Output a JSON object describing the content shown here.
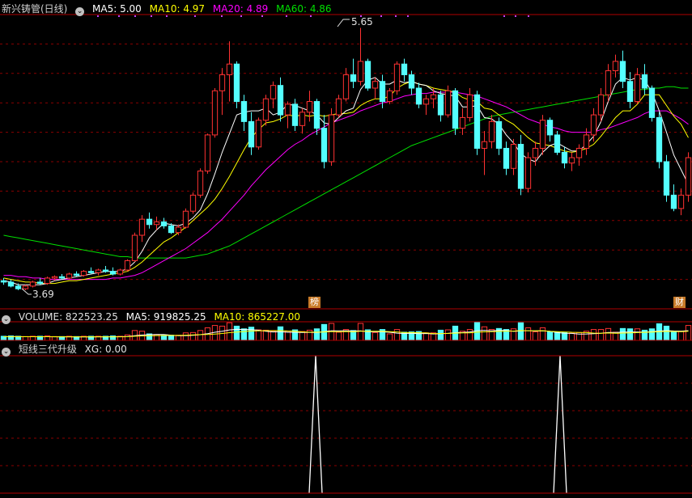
{
  "header": {
    "title": "新兴铸管(日线)",
    "ma5_label": "MA5: 5.00",
    "ma10_label": "MA10: 4.97",
    "ma20_label": "MA20: 4.89",
    "ma60_label": "MA60: 4.86"
  },
  "colors": {
    "up": "#ff3232",
    "down": "#54ffff",
    "ma5": "#ffffff",
    "ma10": "#ffff00",
    "ma20": "#ff00ff",
    "ma60": "#00e000",
    "grid": "#8a0000",
    "border": "#b00000",
    "signal": "#ffffff"
  },
  "price_panel": {
    "high_label": "5.65",
    "low_label": "3.69",
    "event_tags": [
      "榜",
      "财"
    ]
  },
  "volume_panel": {
    "label": "VOLUME: 822523.25",
    "ma5_label": "MA5: 919825.25",
    "ma10_label": "MA10: 865227.00"
  },
  "indicator_panel": {
    "label": "短线三代升级",
    "xg_label": "XG: 0.00"
  },
  "chart_data": {
    "type": "candlestick",
    "y_range": [
      3.55,
      5.75
    ],
    "candles": [
      [
        3.76,
        3.78,
        3.73,
        3.75
      ],
      [
        3.75,
        3.77,
        3.71,
        3.72
      ],
      [
        3.72,
        3.74,
        3.69,
        3.7
      ],
      [
        3.7,
        3.73,
        3.69,
        3.72
      ],
      [
        3.72,
        3.76,
        3.71,
        3.75
      ],
      [
        3.75,
        3.78,
        3.73,
        3.74
      ],
      [
        3.74,
        3.79,
        3.73,
        3.78
      ],
      [
        3.78,
        3.8,
        3.76,
        3.79
      ],
      [
        3.79,
        3.81,
        3.77,
        3.78
      ],
      [
        3.78,
        3.82,
        3.77,
        3.81
      ],
      [
        3.81,
        3.83,
        3.79,
        3.8
      ],
      [
        3.8,
        3.84,
        3.79,
        3.83
      ],
      [
        3.83,
        3.86,
        3.81,
        3.82
      ],
      [
        3.82,
        3.85,
        3.8,
        3.84
      ],
      [
        3.84,
        3.87,
        3.82,
        3.83
      ],
      [
        3.83,
        3.86,
        3.8,
        3.81
      ],
      [
        3.81,
        3.85,
        3.8,
        3.84
      ],
      [
        3.84,
        3.92,
        3.83,
        3.91
      ],
      [
        3.91,
        4.12,
        3.9,
        4.1
      ],
      [
        4.1,
        4.25,
        4.05,
        4.22
      ],
      [
        4.22,
        4.27,
        4.15,
        4.18
      ],
      [
        4.18,
        4.24,
        4.14,
        4.2
      ],
      [
        4.2,
        4.23,
        4.15,
        4.17
      ],
      [
        4.17,
        4.19,
        4.11,
        4.12
      ],
      [
        4.12,
        4.18,
        4.1,
        4.16
      ],
      [
        4.16,
        4.3,
        4.15,
        4.28
      ],
      [
        4.28,
        4.42,
        4.26,
        4.4
      ],
      [
        4.4,
        4.6,
        4.38,
        4.58
      ],
      [
        4.58,
        4.86,
        4.56,
        4.85
      ],
      [
        4.85,
        5.2,
        4.83,
        5.18
      ],
      [
        5.18,
        5.35,
        5.0,
        5.3
      ],
      [
        5.3,
        5.55,
        5.1,
        5.38
      ],
      [
        5.38,
        5.4,
        5.05,
        5.1
      ],
      [
        5.1,
        5.15,
        4.88,
        4.95
      ],
      [
        4.95,
        5.02,
        4.7,
        4.76
      ],
      [
        4.76,
        4.98,
        4.74,
        4.96
      ],
      [
        4.96,
        5.15,
        4.92,
        5.12
      ],
      [
        5.12,
        5.25,
        5.05,
        5.22
      ],
      [
        5.22,
        5.28,
        4.95,
        5.0
      ],
      [
        5.0,
        5.1,
        4.9,
        5.08
      ],
      [
        5.08,
        5.12,
        4.88,
        4.92
      ],
      [
        4.92,
        5.05,
        4.86,
        5.02
      ],
      [
        5.02,
        5.18,
        4.95,
        5.1
      ],
      [
        5.1,
        5.12,
        4.85,
        4.9
      ],
      [
        4.9,
        5.0,
        4.6,
        4.65
      ],
      [
        4.65,
        5.05,
        4.62,
        5.0
      ],
      [
        5.0,
        5.15,
        4.98,
        5.12
      ],
      [
        5.12,
        5.35,
        5.1,
        5.3
      ],
      [
        5.3,
        5.42,
        5.2,
        5.25
      ],
      [
        5.25,
        5.65,
        5.22,
        5.4
      ],
      [
        5.4,
        5.42,
        5.18,
        5.2
      ],
      [
        5.2,
        5.28,
        5.12,
        5.25
      ],
      [
        5.25,
        5.3,
        5.05,
        5.1
      ],
      [
        5.1,
        5.2,
        5.08,
        5.18
      ],
      [
        5.18,
        5.4,
        5.15,
        5.38
      ],
      [
        5.38,
        5.42,
        5.25,
        5.3
      ],
      [
        5.3,
        5.33,
        5.15,
        5.2
      ],
      [
        5.2,
        5.24,
        5.05,
        5.08
      ],
      [
        5.08,
        5.15,
        5.0,
        5.12
      ],
      [
        5.12,
        5.2,
        5.05,
        5.15
      ],
      [
        5.15,
        5.18,
        4.95,
        5.0
      ],
      [
        5.0,
        5.22,
        4.98,
        5.18
      ],
      [
        5.18,
        5.2,
        4.85,
        4.9
      ],
      [
        4.9,
        5.05,
        4.85,
        4.98
      ],
      [
        4.98,
        5.2,
        4.95,
        5.15
      ],
      [
        5.15,
        5.18,
        4.7,
        4.75
      ],
      [
        4.75,
        4.88,
        4.55,
        4.8
      ],
      [
        4.8,
        5.0,
        4.75,
        4.95
      ],
      [
        4.95,
        4.98,
        4.7,
        4.75
      ],
      [
        4.75,
        4.8,
        4.55,
        4.6
      ],
      [
        4.6,
        4.82,
        4.55,
        4.78
      ],
      [
        4.78,
        4.85,
        4.4,
        4.45
      ],
      [
        4.45,
        4.72,
        4.42,
        4.68
      ],
      [
        4.68,
        4.8,
        4.62,
        4.75
      ],
      [
        4.75,
        5.0,
        4.7,
        4.96
      ],
      [
        4.96,
        4.98,
        4.8,
        4.85
      ],
      [
        4.85,
        4.88,
        4.7,
        4.72
      ],
      [
        4.72,
        4.76,
        4.6,
        4.64
      ],
      [
        4.64,
        4.72,
        4.58,
        4.68
      ],
      [
        4.68,
        4.78,
        4.62,
        4.75
      ],
      [
        4.75,
        4.9,
        4.7,
        4.85
      ],
      [
        4.85,
        5.05,
        4.8,
        5.0
      ],
      [
        5.0,
        5.2,
        4.95,
        5.15
      ],
      [
        5.15,
        5.38,
        5.1,
        5.33
      ],
      [
        5.33,
        5.45,
        5.28,
        5.4
      ],
      [
        5.4,
        5.48,
        5.2,
        5.25
      ],
      [
        5.25,
        5.32,
        5.05,
        5.1
      ],
      [
        5.1,
        5.35,
        5.08,
        5.3
      ],
      [
        5.3,
        5.38,
        5.15,
        5.2
      ],
      [
        5.2,
        5.22,
        4.95,
        4.98
      ],
      [
        4.98,
        5.02,
        4.6,
        4.65
      ],
      [
        4.65,
        4.7,
        4.35,
        4.4
      ],
      [
        4.4,
        4.48,
        4.28,
        4.3
      ],
      [
        4.3,
        4.45,
        4.25,
        4.4
      ],
      [
        4.4,
        4.72,
        4.35,
        4.68
      ]
    ],
    "ma5": [
      3.76,
      3.75,
      3.73,
      3.73,
      3.73,
      3.73,
      3.74,
      3.76,
      3.77,
      3.78,
      3.79,
      3.8,
      3.81,
      3.82,
      3.83,
      3.83,
      3.83,
      3.85,
      3.9,
      3.98,
      4.08,
      4.14,
      4.19,
      4.18,
      4.17,
      4.19,
      4.23,
      4.29,
      4.41,
      4.56,
      4.72,
      4.86,
      5.0,
      5.02,
      5.03,
      5.03,
      5.05,
      5.0,
      5.02,
      5.08,
      5.07,
      5.05,
      5.03,
      5.0,
      4.94,
      4.93,
      4.98,
      5.03,
      5.05,
      5.19,
      5.26,
      5.28,
      5.23,
      5.23,
      5.26,
      5.24,
      5.25,
      5.23,
      5.22,
      5.18,
      5.16,
      5.15,
      5.14,
      5.06,
      5.06,
      5.07,
      4.98,
      4.97,
      4.93,
      4.85,
      4.79,
      4.71,
      4.67,
      4.65,
      4.72,
      4.77,
      4.79,
      4.76,
      4.73,
      4.73,
      4.78,
      4.84,
      4.95,
      5.1,
      5.23,
      5.28,
      5.26,
      5.28,
      5.26,
      5.17,
      5.03,
      4.87,
      4.7,
      4.59,
      4.48
    ],
    "ma10": [
      3.78,
      3.77,
      3.76,
      3.75,
      3.75,
      3.74,
      3.74,
      3.74,
      3.75,
      3.76,
      3.76,
      3.77,
      3.78,
      3.79,
      3.8,
      3.81,
      3.82,
      3.83,
      3.86,
      3.9,
      3.95,
      4.0,
      4.05,
      4.08,
      4.12,
      4.16,
      4.21,
      4.26,
      4.31,
      4.37,
      4.45,
      4.54,
      4.64,
      4.74,
      4.83,
      4.89,
      4.94,
      4.95,
      4.97,
      5.0,
      4.99,
      5.0,
      4.99,
      5.0,
      4.99,
      5.0,
      5.01,
      5.01,
      5.02,
      5.07,
      5.1,
      5.12,
      5.12,
      5.14,
      5.2,
      5.23,
      5.25,
      5.23,
      5.22,
      5.2,
      5.19,
      5.18,
      5.17,
      5.13,
      5.11,
      5.1,
      5.05,
      5.04,
      5.0,
      4.96,
      4.93,
      4.88,
      4.83,
      4.79,
      4.78,
      4.77,
      4.75,
      4.73,
      4.72,
      4.73,
      4.75,
      4.78,
      4.84,
      4.91,
      4.98,
      5.03,
      5.03,
      5.08,
      5.15,
      5.15,
      5.15,
      5.07,
      4.99,
      4.93,
      4.83
    ],
    "ma20": [
      3.8,
      3.8,
      3.79,
      3.79,
      3.78,
      3.78,
      3.77,
      3.77,
      3.77,
      3.77,
      3.77,
      3.77,
      3.77,
      3.77,
      3.77,
      3.78,
      3.78,
      3.79,
      3.8,
      3.82,
      3.85,
      3.88,
      3.91,
      3.94,
      3.97,
      4.0,
      4.04,
      4.08,
      4.12,
      4.17,
      4.22,
      4.28,
      4.34,
      4.4,
      4.47,
      4.53,
      4.59,
      4.64,
      4.69,
      4.74,
      4.78,
      4.81,
      4.85,
      4.88,
      4.91,
      4.94,
      4.96,
      4.98,
      5.0,
      5.03,
      5.05,
      5.07,
      5.09,
      5.1,
      5.12,
      5.14,
      5.15,
      5.16,
      5.16,
      5.17,
      5.17,
      5.17,
      5.17,
      5.16,
      5.15,
      5.14,
      5.12,
      5.1,
      5.08,
      5.06,
      5.03,
      5.0,
      4.97,
      4.95,
      4.93,
      4.91,
      4.9,
      4.88,
      4.87,
      4.87,
      4.87,
      4.87,
      4.89,
      4.9,
      4.92,
      4.94,
      4.96,
      4.98,
      5.01,
      5.03,
      5.03,
      5.03,
      5.0,
      4.97,
      4.93
    ],
    "ma60": [
      4.1,
      4.09,
      4.08,
      4.07,
      4.06,
      4.05,
      4.04,
      4.03,
      4.02,
      4.01,
      4.0,
      3.99,
      3.98,
      3.97,
      3.96,
      3.95,
      3.94,
      3.94,
      3.93,
      3.93,
      3.93,
      3.93,
      3.93,
      3.93,
      3.93,
      3.93,
      3.94,
      3.95,
      3.96,
      3.98,
      4.0,
      4.02,
      4.05,
      4.08,
      4.11,
      4.14,
      4.17,
      4.2,
      4.23,
      4.26,
      4.29,
      4.32,
      4.35,
      4.38,
      4.41,
      4.44,
      4.47,
      4.5,
      4.53,
      4.56,
      4.59,
      4.62,
      4.65,
      4.68,
      4.71,
      4.74,
      4.77,
      4.79,
      4.81,
      4.83,
      4.85,
      4.87,
      4.89,
      4.91,
      4.93,
      4.95,
      4.97,
      4.99,
      5.0,
      5.01,
      5.02,
      5.03,
      5.04,
      5.05,
      5.06,
      5.07,
      5.08,
      5.09,
      5.1,
      5.11,
      5.12,
      5.13,
      5.14,
      5.15,
      5.16,
      5.17,
      5.18,
      5.19,
      5.19,
      5.2,
      5.2,
      5.21,
      5.21,
      5.2,
      5.2
    ],
    "signals": [
      50,
      88
    ]
  }
}
